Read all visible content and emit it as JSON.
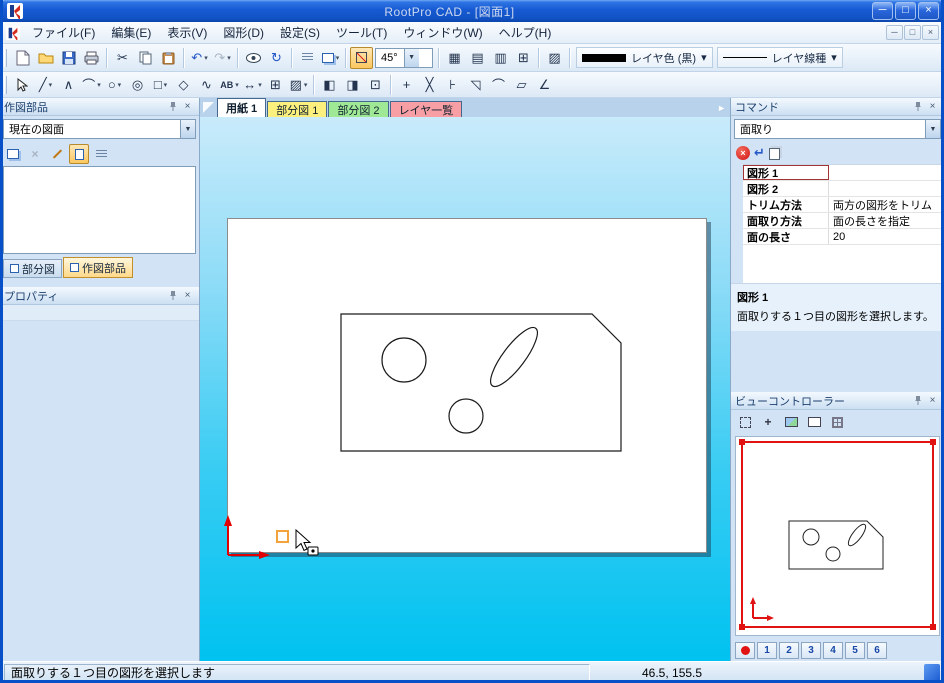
{
  "titlebar": {
    "title": "RootPro CAD - [図面1]"
  },
  "menu": {
    "items": [
      "ファイル(F)",
      "編集(E)",
      "表示(V)",
      "図形(D)",
      "設定(S)",
      "ツール(T)",
      "ウィンドウ(W)",
      "ヘルプ(H)"
    ]
  },
  "toolbar": {
    "angle": "45°",
    "layer_color": "レイヤ色 (黒)",
    "layer_linetype": "レイヤ線種"
  },
  "left": {
    "parts_title": "作図部品",
    "combo": "現在の図面",
    "tab_partial": "部分図",
    "tab_parts": "作図部品",
    "props_title": "プロパティ"
  },
  "doc_tabs": {
    "t1": "用紙 1",
    "t2": "部分図 1",
    "t3": "部分図 2",
    "t4": "レイヤ一覧"
  },
  "command": {
    "title": "コマンド",
    "combo": "面取り",
    "rows": [
      {
        "label": "図形 1",
        "value": ""
      },
      {
        "label": "図形 2",
        "value": ""
      },
      {
        "label": "トリム方法",
        "value": "両方の図形をトリム"
      },
      {
        "label": "面取り方法",
        "value": "面の長さを指定"
      },
      {
        "label": "面の長さ",
        "value": "20"
      }
    ],
    "desc_title": "図形 1",
    "desc_text": "面取りする１つ目の図形を選択します。"
  },
  "view": {
    "title": "ビューコントローラー",
    "buttons": [
      "1",
      "2",
      "3",
      "4",
      "5",
      "6"
    ]
  },
  "status": {
    "message": "面取りする１つ目の図形を選択します",
    "coords": "46.5, 155.5"
  },
  "colors": {
    "accent_orange": "#FCC75F",
    "canvas_cyan": "#00C2F0",
    "select_red": "#E01212",
    "layer_black": "#000000"
  },
  "icons": {
    "minimize": "─",
    "maximize": "□",
    "close": "×",
    "caret": "▾",
    "combo_arrow": "▼",
    "cut": "✂",
    "undo": "↶",
    "redo": "↷",
    "refresh": "↻",
    "line": "╱",
    "polyline": "∧",
    "arc": "⌒",
    "circle": "○",
    "ellipse": "◎",
    "rect": "□",
    "polygon": "◇",
    "spline": "∿",
    "text_tool": "AB",
    "dimension": "↔",
    "table": "⊞",
    "hatch": "▨",
    "grid_a": "▦",
    "grid_b": "▤",
    "grid_c": "▥",
    "grid_d": "⊞",
    "part_a": "◧",
    "part_b": "◨",
    "part_c": "⊡",
    "trim": "╳",
    "extend": "⊦",
    "chamfer": "◹",
    "fillet": "⌒",
    "erase": "▱",
    "measure": "∠",
    "enter": "↵",
    "move": "+",
    "tab_next": "►",
    "x_small": "×"
  }
}
